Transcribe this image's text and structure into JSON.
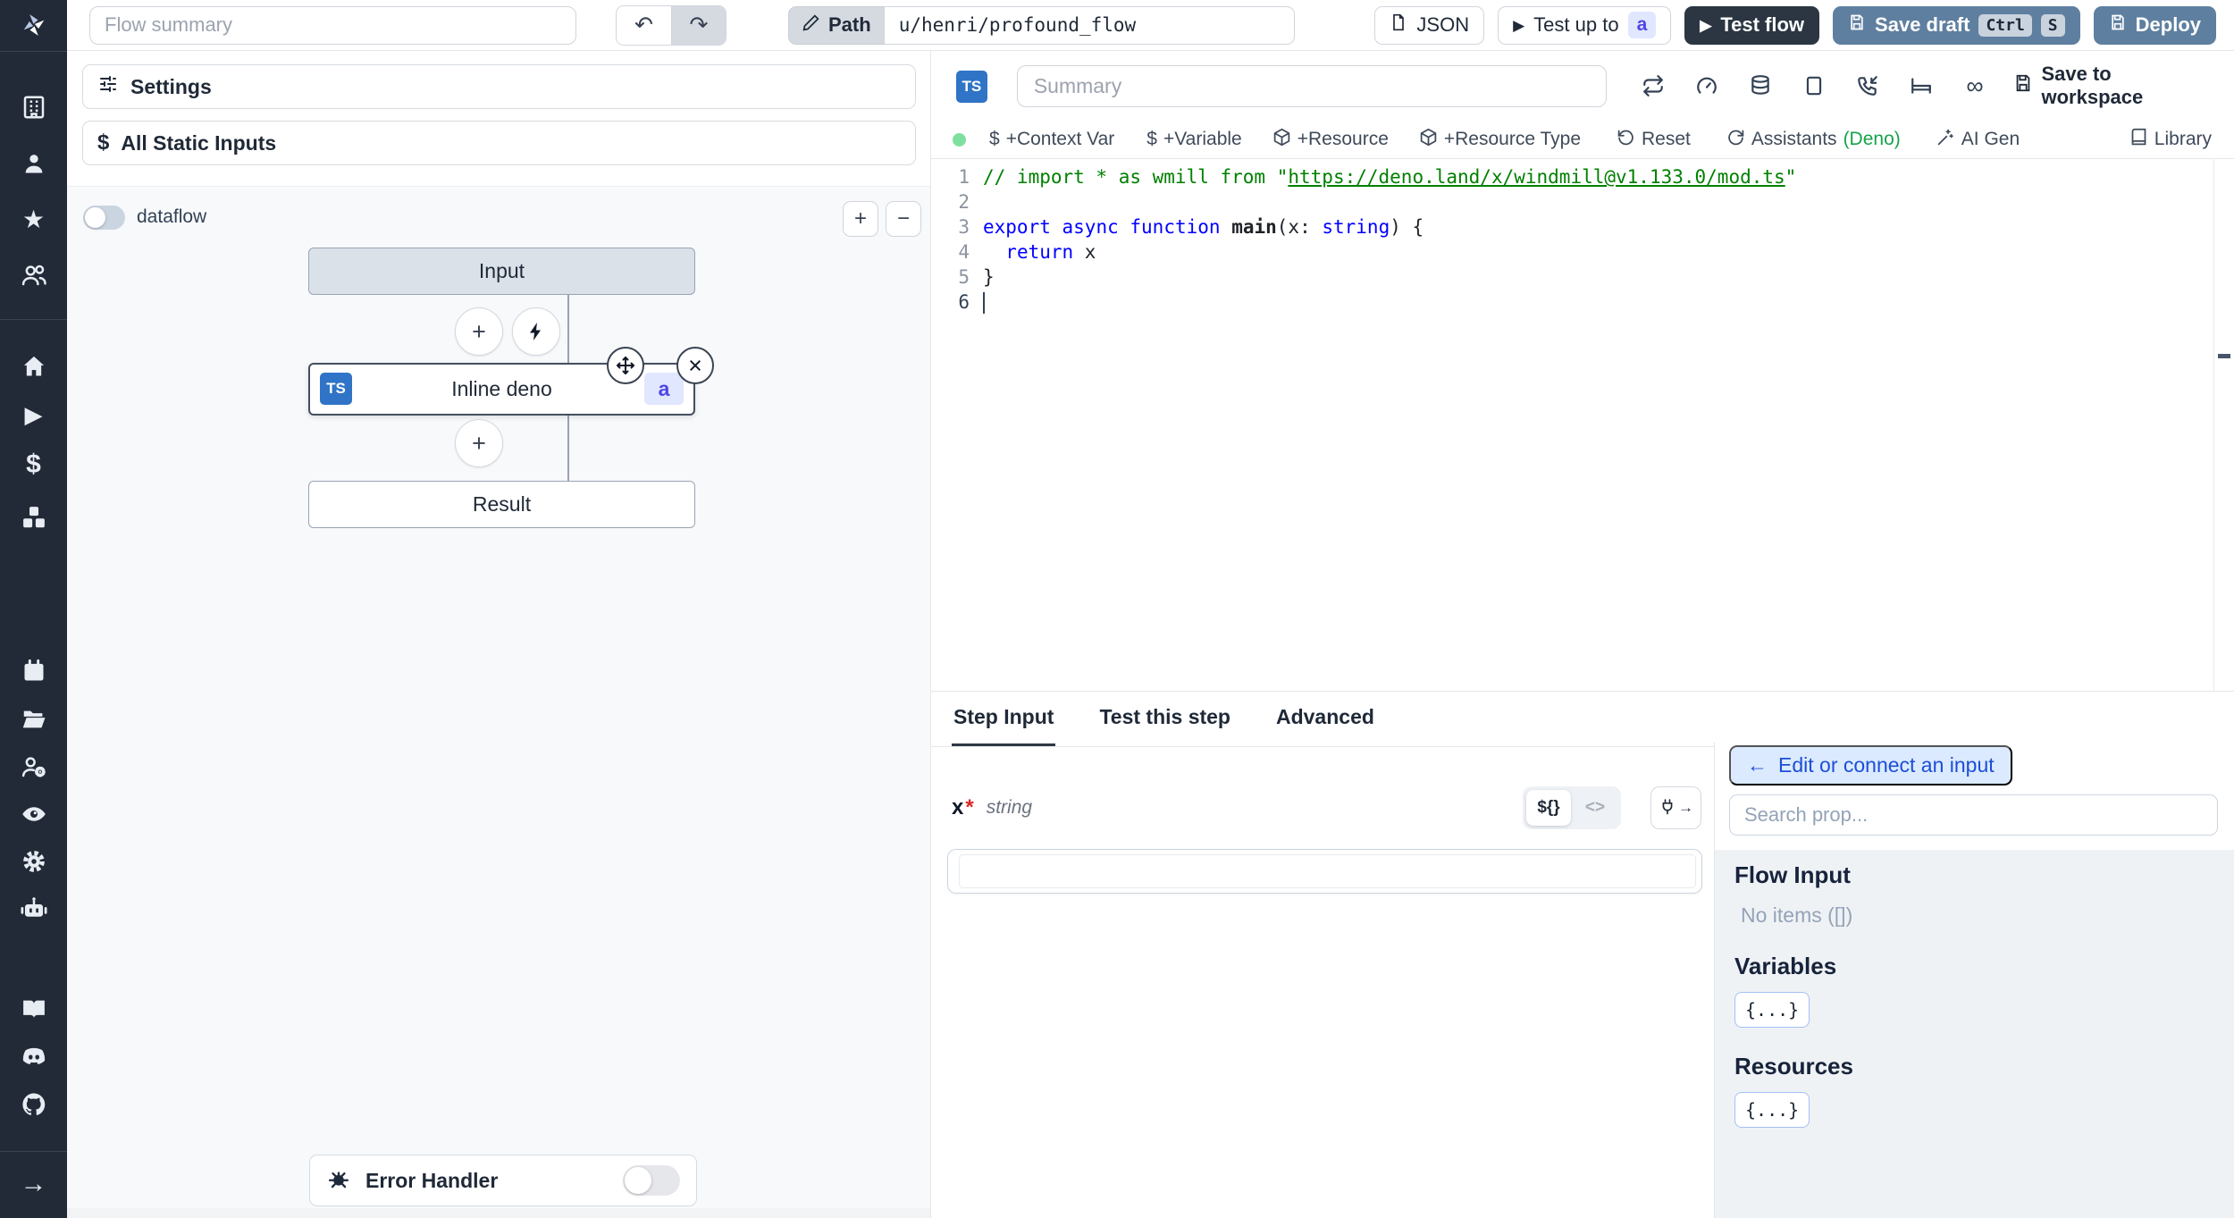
{
  "icons": {
    "undo": "↶",
    "redo": "↷",
    "play": "▶",
    "arrow_right": "→",
    "arrow_left": "←",
    "infinity": "∞",
    "close": "×",
    "plus": "+",
    "minus": "−",
    "star": "★",
    "dollar": "$",
    "template_toggle": "${}",
    "code_toggle": "<>",
    "braces_pill": "{...}"
  },
  "topbar": {
    "flow_summary_placeholder": "Flow summary",
    "path_label": "Path",
    "path_value": "u/henri/profound_flow",
    "json_label": "JSON",
    "test_up_to_label": "Test up to",
    "test_up_to_badge": "a",
    "test_flow_label": "Test flow",
    "save_draft_label": "Save draft",
    "kbd_ctrl": "Ctrl",
    "kbd_s": "S",
    "deploy_label": "Deploy"
  },
  "flow_panel": {
    "settings_label": "Settings",
    "static_inputs_label": "All Static Inputs",
    "dataflow_label": "dataflow",
    "input_node_label": "Input",
    "step_lang_badge": "TS",
    "step_node_label": "Inline deno",
    "step_id_badge": "a",
    "result_node_label": "Result",
    "error_handler_label": "Error Handler"
  },
  "editor": {
    "lang_badge": "TS",
    "summary_placeholder": "Summary",
    "save_to_workspace_label": "Save to workspace",
    "context_var_label": "+Context Var",
    "variable_label": "+Variable",
    "resource_label": "+Resource",
    "resource_type_label": "+Resource Type",
    "reset_label": "Reset",
    "assistants_label": "Assistants",
    "assistants_lang": "(Deno)",
    "ai_gen_label": "AI Gen",
    "library_label": "Library",
    "code_lines": [
      {
        "n": "1",
        "tokens": [
          {
            "c": "comment",
            "t": "// import * as wmill from \""
          },
          {
            "c": "comment link",
            "t": "https://deno.land/x/windmill@v1.133.0/mod.ts"
          },
          {
            "c": "comment",
            "t": "\""
          }
        ]
      },
      {
        "n": "2",
        "tokens": []
      },
      {
        "n": "3",
        "tokens": [
          {
            "c": "kw",
            "t": "export"
          },
          {
            "c": "plain",
            "t": " "
          },
          {
            "c": "kw",
            "t": "async"
          },
          {
            "c": "plain",
            "t": " "
          },
          {
            "c": "kw",
            "t": "function"
          },
          {
            "c": "plain",
            "t": " "
          },
          {
            "c": "fn",
            "t": "main"
          },
          {
            "c": "plain",
            "t": "(x: "
          },
          {
            "c": "kw",
            "t": "string"
          },
          {
            "c": "plain",
            "t": ") {"
          }
        ]
      },
      {
        "n": "4",
        "tokens": [
          {
            "c": "plain",
            "t": "  "
          },
          {
            "c": "kw",
            "t": "return"
          },
          {
            "c": "plain",
            "t": " x"
          }
        ]
      },
      {
        "n": "5",
        "tokens": [
          {
            "c": "plain",
            "t": "}"
          }
        ]
      },
      {
        "n": "6",
        "tokens": [],
        "cursor": true,
        "active": true
      }
    ]
  },
  "tabs": [
    {
      "label": "Step Input",
      "active": true
    },
    {
      "label": "Test this step"
    },
    {
      "label": "Advanced"
    }
  ],
  "step_input": {
    "field_name": "x",
    "required_mark": "*",
    "field_type": "string",
    "input_value": ""
  },
  "connect_panel": {
    "edit_button_label": "Edit or connect an input",
    "search_placeholder": "Search prop...",
    "flow_input_heading": "Flow Input",
    "no_items_text": "No items ([])",
    "variables_heading": "Variables",
    "resources_heading": "Resources"
  }
}
